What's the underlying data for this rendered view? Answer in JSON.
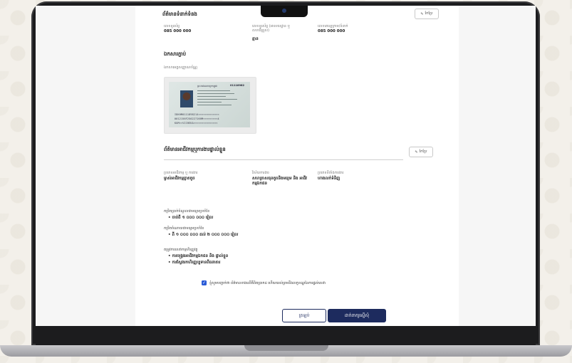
{
  "contact": {
    "title": "ព័ត៌មានទំនាក់ទំនង",
    "edit_label": "កែប្រែ",
    "phone_label": "លេខទូរស័ព្ទ",
    "phone_value": "085 000 000",
    "alt_label": "លេខទូរស័ព្ទ (អាសយដ្ឋាន ឬ សហជីព្រូស)",
    "alt_value": "គ្មាន",
    "tg_label": "លេខតេឡេក្រាម/ទំនាក់",
    "tg_value": "085 000 000"
  },
  "documents": {
    "title": "ឯកសារភ្ជាប់",
    "id_label": "ឯកសារអត្តសញ្ញាណប័ណ្ណ",
    "card_header": "ព្រះរាជាណាចក្រកម្ពុជា",
    "card_number": "01118982",
    "mrz": [
      "IDKHM0111898214<<<<<<<<<<<<<",
      "0012156F2502271KHM<<<<<<<<<4",
      "KUM<<VICHEKA<<<<<<<<<<<<<<<"
    ]
  },
  "business": {
    "title": "ព័ត៌មានអាជីវកម្មឬការងារផ្ទាល់ខ្លួន",
    "edit_label": "កែប្រែ",
    "type_label": "ប្រភេទអាជីវកម្ម ឬ ការងារ",
    "type_value": "ម្ចាស់អាជីវកម្មខ្នាតតូច",
    "sector_label": "វិស័យការងារ",
    "sector_value": "សហគ្រាសធុនតូចនិងមធ្យម និង អាជីវកម្មឯកជន",
    "location_label": "ប្រភេទទីតាំងការងារ",
    "location_value": "ហាងលក់ទំនិញ",
    "income_q": "កម្រិតប្រាក់ចំណូលជាមធ្យមប្រចាំខែ",
    "income_a": "ចាប់ពី ១ ០០០ ០០០ រៀល",
    "expense_q": "កម្រិតចំណាយជាមធ្យមប្រចាំខែ",
    "expense_a": "ពី ១ ០០០ ០០០ ដល់ ២ ០០០ ០០០ រៀល",
    "needs_q": "តម្រូវការសេវាកម្មហិរញ្ញវត្ថុ",
    "needs": [
      "ការចង្ក្រងអាជីវកម្មឯកជន និង ផ្ទាល់ខ្លួន",
      "ការស្វែងរកហិរញ្ញប្បទានពីធនាគារ"
    ]
  },
  "consent": {
    "text": "ខ្ញុំសូមបញ្ជាក់ថា ព័ត៌មានខាងលើគឺពិតប្រាកដ ហើយយល់ព្រមនឹងលក្ខខណ្ឌនៃការផ្តល់សេវា"
  },
  "actions": {
    "back_label": "ត្រឡប់",
    "submit_label": "ដាក់ពាក្យស្នើសុំ"
  }
}
